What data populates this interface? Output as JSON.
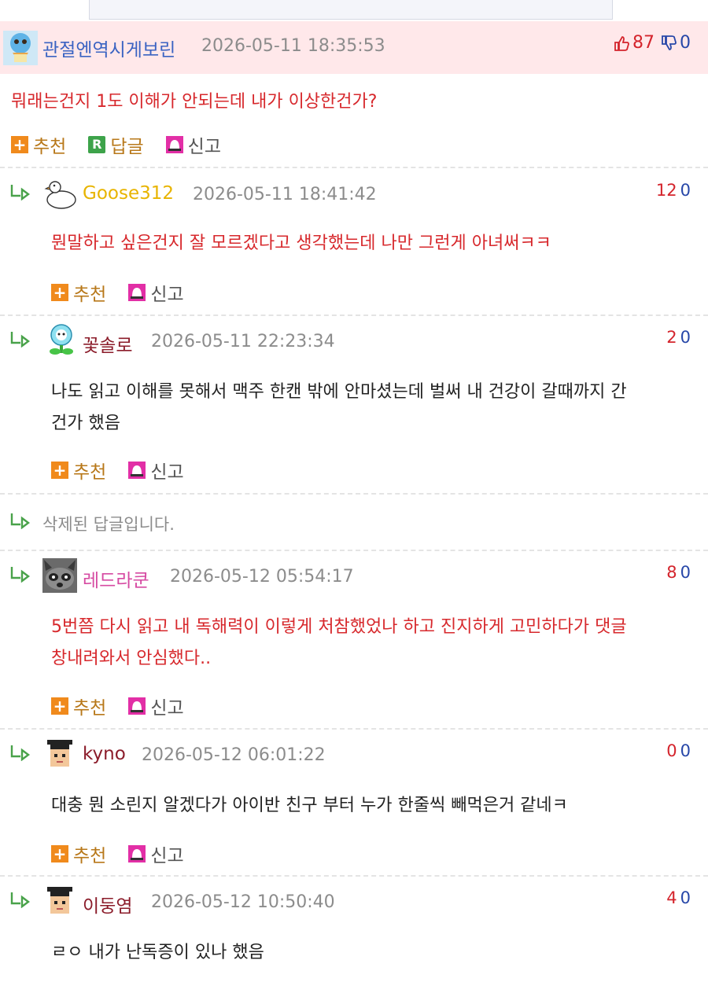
{
  "main_comment": {
    "nick": "관절엔역시게보린",
    "date": "2026-05-11 18:35:53",
    "up": "87",
    "down": "0",
    "text": "뭐래는건지 1도 이해가 안되는데 내가 이상한건가?",
    "actions": {
      "recommend": "추천",
      "reply": "답글",
      "report": "신고"
    }
  },
  "replies": [
    {
      "nick": "Goose312",
      "nick_color": "#e8b400",
      "date": "2026-05-11 18:41:42",
      "up": "12",
      "down": "0",
      "lines": [
        "뭔말하고 싶은건지 잘 모르겠다고 생각했는데 나만 그런게 아녀써ㅋㅋ"
      ],
      "text_color": "#d7282c",
      "recommend": "추천",
      "report": "신고"
    },
    {
      "nick": "꽃솔로",
      "nick_color": "#8b1c2a",
      "date": "2026-05-11 22:23:34",
      "up": "2",
      "down": "0",
      "lines": [
        "나도 읽고 이해를 못해서 맥주 한캔 밖에 안마셨는데 벌써 내 건강이 갈때까지 간",
        "건가 했음"
      ],
      "text_color": "#222222",
      "recommend": "추천",
      "report": "신고"
    },
    {
      "deleted_text": "삭제된 답글입니다."
    },
    {
      "nick": "레드라쿤",
      "nick_color": "#d64aa2",
      "date": "2026-05-12 05:54:17",
      "up": "8",
      "down": "0",
      "lines": [
        "5번쯤 다시 읽고 내 독해력이 이렇게 처참했었나 하고 진지하게 고민하다가 댓글",
        "창내려와서 안심했다.."
      ],
      "text_color": "#d7282c",
      "recommend": "추천",
      "report": "신고"
    },
    {
      "nick": "kyno",
      "nick_color": "#8b1c2a",
      "date": "2026-05-12 06:01:22",
      "up": "0",
      "down": "0",
      "lines": [
        "대충 뭔 소린지 알겠다가 아이반 친구 부터 누가 한줄씩 빼먹은거 같네ㅋ"
      ],
      "text_color": "#222222",
      "recommend": "추천",
      "report": "신고"
    },
    {
      "nick": "이둥염",
      "nick_color": "#8b1c2a",
      "date": "2026-05-12 10:50:40",
      "up": "4",
      "down": "0",
      "lines": [
        "ㄹㅇ 내가 난독증이 있나 했음"
      ],
      "text_color": "#222222"
    }
  ],
  "colors": {
    "highlight_bg": "#ffe8ea",
    "up": "#d4242c",
    "down": "#2747a8",
    "action": "#b8781a"
  }
}
